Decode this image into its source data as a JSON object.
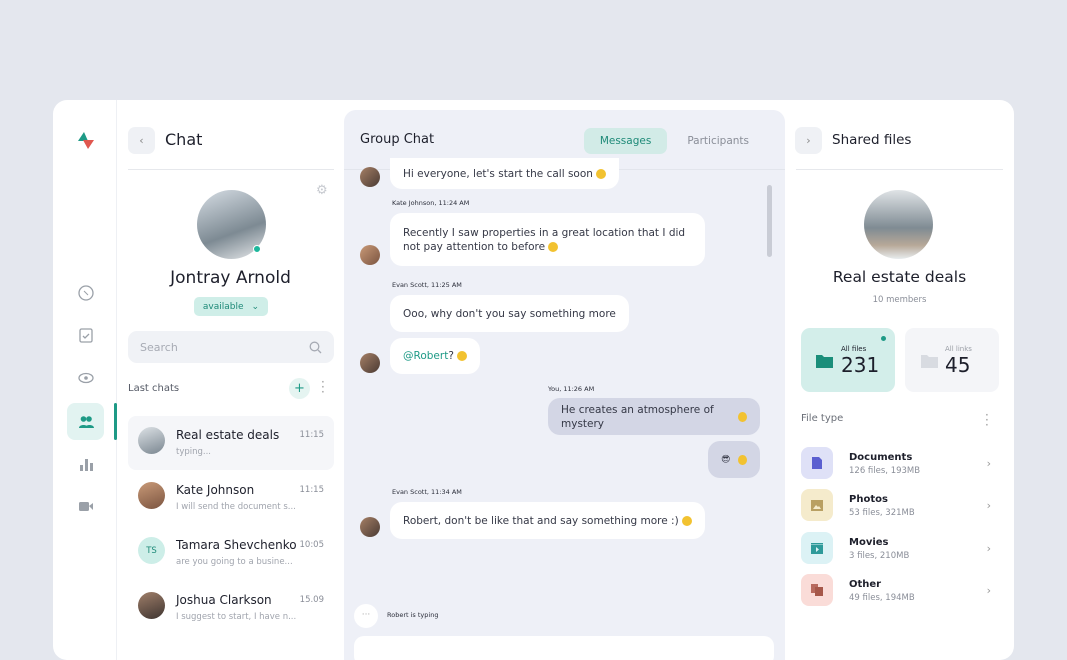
{
  "colors": {
    "accent": "#1e9a86",
    "background": "#e4e7ee",
    "chat_bg": "#eef0f7"
  },
  "rail": {
    "items": [
      {
        "icon": "dashboard-icon"
      },
      {
        "icon": "clipboard-check-icon"
      },
      {
        "icon": "eye-icon"
      },
      {
        "icon": "users-icon",
        "active": true
      },
      {
        "icon": "bar-chart-icon"
      },
      {
        "icon": "video-icon"
      }
    ]
  },
  "left": {
    "title": "Chat",
    "profile": {
      "name": "Jontray Arnold",
      "status": "available"
    },
    "search_placeholder": "Search",
    "last_chats_label": "Last chats",
    "chats": [
      {
        "name": "Real estate deals",
        "time": "11:15",
        "preview": "typing...",
        "selected": true
      },
      {
        "name": "Kate Johnson",
        "time": "11:15",
        "preview": "I will send the document s..."
      },
      {
        "name": "Tamara Shevchenko",
        "time": "10:05",
        "preview": "are you going to a busine...",
        "initials": "TS"
      },
      {
        "name": "Joshua Clarkson",
        "time": "15.09",
        "preview": "I suggest to start, I have n..."
      }
    ]
  },
  "center": {
    "title": "Group Chat",
    "tabs": [
      {
        "label": "Messages",
        "active": true
      },
      {
        "label": "Participants"
      }
    ],
    "messages": [
      {
        "text": "Hi everyone, let's start the call soon"
      },
      {
        "meta": "Kate Johnson, 11:24 AM",
        "text": "Recently I saw properties in a great location that I did not pay attention to before"
      },
      {
        "meta": "Evan Scott, 11:25 AM",
        "text": "Ooo, why don't you say something more"
      },
      {
        "mention": "@Robert",
        "text": " ?"
      },
      {
        "meta": "You, 11:26 AM",
        "text": "He creates an atmosphere of mystery"
      },
      {
        "text": "😎"
      },
      {
        "meta": "Evan Scott, 11:34 AM",
        "text": "Robert, don't be like that and say something more :)"
      }
    ],
    "typing": "Robert is typing"
  },
  "right": {
    "title": "Shared files",
    "group": {
      "name": "Real estate deals",
      "members": "10 members"
    },
    "stats": [
      {
        "label": "All files",
        "value": "231"
      },
      {
        "label": "All links",
        "value": "45"
      }
    ],
    "file_type_label": "File type",
    "file_types": [
      {
        "name": "Documents",
        "sub": "126 files, 193MB",
        "color": "#dfe1f7",
        "icon_color": "#5b5fd0"
      },
      {
        "name": "Photos",
        "sub": "53 files, 321MB",
        "color": "#f5ebcc",
        "icon_color": "#b9a063"
      },
      {
        "name": "Movies",
        "sub": "3 files, 210MB",
        "color": "#dcf2f5",
        "icon_color": "#2f9a9a"
      },
      {
        "name": "Other",
        "sub": "49 files, 194MB",
        "color": "#fadcd8",
        "icon_color": "#b86a5e"
      }
    ]
  }
}
